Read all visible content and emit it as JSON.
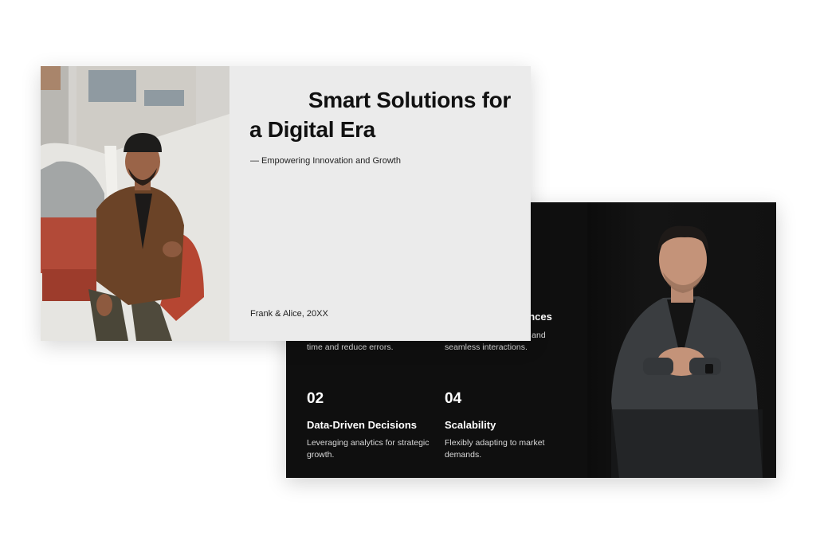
{
  "front_slide": {
    "title_line1": "Smart Solutions for",
    "title_line2": "a Digital Era",
    "subtitle": "— Empowering Innovation and Growth",
    "footer": "Frank & Alice, 20XX",
    "background": "#ebebeb"
  },
  "back_slide": {
    "background": "#0f0f0f",
    "features": [
      {
        "number": "",
        "title": "",
        "description": "Automating routine tasks to save time and reduce errors."
      },
      {
        "number": "02",
        "title": "Data-Driven Decisions",
        "description": "Leveraging analytics for strategic growth."
      },
      {
        "number": "",
        "title": "ences",
        "description": "Providing personalized and seamless interactions."
      },
      {
        "number": "04",
        "title": "Scalability",
        "description": "Flexibly adapting to market demands."
      }
    ]
  }
}
